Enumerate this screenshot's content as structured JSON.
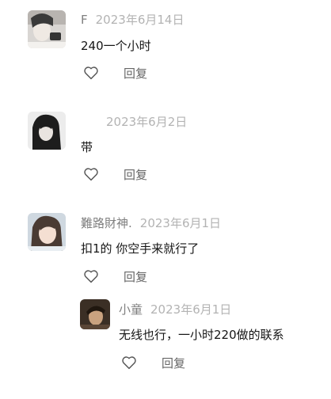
{
  "comments": [
    {
      "username": "F",
      "date": "2023年6月14日",
      "text": "240一个小时",
      "reply_label": "回复",
      "like_icon": "heart-outline-icon"
    },
    {
      "username": "",
      "date": "2023年6月2日",
      "text": "带",
      "reply_label": "回复",
      "like_icon": "heart-outline-icon"
    },
    {
      "username": "難路財神.",
      "date": "2023年6月1日",
      "text": "扣1的 你空手来就行了",
      "reply_label": "回复",
      "like_icon": "heart-outline-icon"
    },
    {
      "username": "小童",
      "date": "2023年6月1日",
      "text": "无线也行，一小时220做的联系",
      "reply_label": "回复",
      "like_icon": "heart-outline-icon"
    }
  ]
}
